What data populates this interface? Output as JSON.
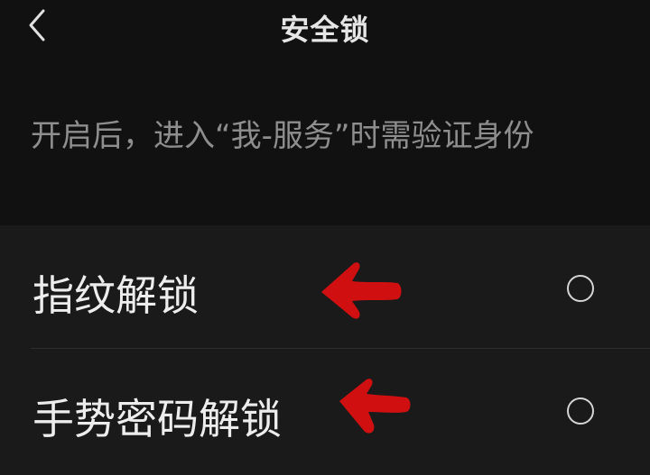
{
  "header": {
    "title": "安全锁",
    "back_icon": "chevron-left-icon"
  },
  "description": "开启后，进入“我-服务”时需验证身份",
  "options": [
    {
      "label": "指纹解锁",
      "selected": false,
      "annotation_color": "#d01010"
    },
    {
      "label": "手势密码解锁",
      "selected": false,
      "annotation_color": "#d01010"
    }
  ],
  "colors": {
    "background": "#111111",
    "list_background": "#1a1a1a",
    "annotation_arrow": "#d01010"
  }
}
